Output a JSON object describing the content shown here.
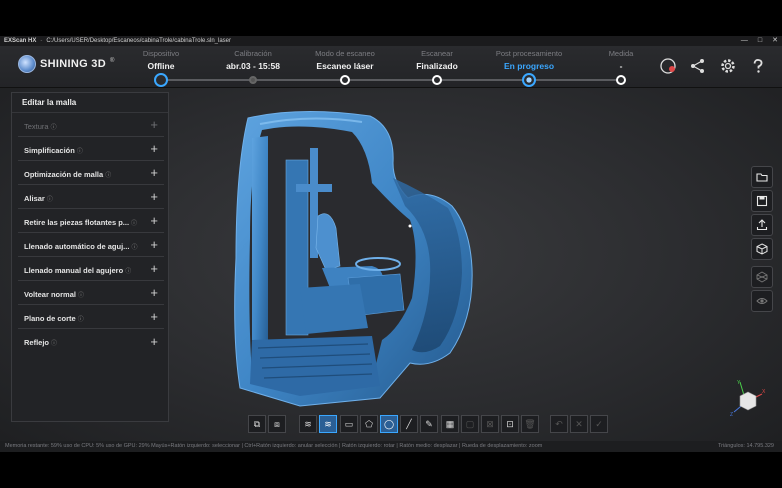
{
  "window": {
    "app_name": "EXScan HX",
    "path": "C:/Users/USER/Desktop/Escaneos/cabinaTrole/cabinaTrole.sln_laser",
    "controls": [
      "—",
      "□",
      "✕"
    ]
  },
  "brand": {
    "name": "SHINING 3D",
    "reg": "®"
  },
  "steps": [
    {
      "label": "Dispositivo",
      "value": "Offline",
      "state": "done"
    },
    {
      "label": "Calibración",
      "value": "abr.03 - 15:58",
      "state": "gray"
    },
    {
      "label": "Modo de escaneo",
      "value": "Escaneo láser",
      "state": "normal"
    },
    {
      "label": "Escanear",
      "value": "Finalizado",
      "state": "normal"
    },
    {
      "label": "Post procesamiento",
      "value": "En progreso",
      "state": "current"
    },
    {
      "label": "Medida",
      "value": "-",
      "state": "normal"
    }
  ],
  "header_icons": [
    "model-icon",
    "share-icon",
    "settings-icon",
    "help-icon"
  ],
  "panel": {
    "title": "Editar la malla",
    "items": [
      {
        "label": "Textura",
        "disabled": true
      },
      {
        "label": "Simplificación",
        "disabled": false
      },
      {
        "label": "Optimización de malla",
        "disabled": false
      },
      {
        "label": "Alisar",
        "disabled": false
      },
      {
        "label": "Retire las piezas flotantes p...",
        "disabled": false
      },
      {
        "label": "Llenado automático de aguj...",
        "disabled": false
      },
      {
        "label": "Llenado manual del agujero",
        "disabled": false
      },
      {
        "label": "Voltear normal",
        "disabled": false
      },
      {
        "label": "Plano de corte",
        "disabled": false
      },
      {
        "label": "Reflejo",
        "disabled": false
      }
    ],
    "info_glyph": "ⓘ",
    "plus_glyph": "+"
  },
  "status_bar": {
    "text": "Memoria restante: 59%  uso de CPU: 5%  uso de GPU: 29%  Mayús+Ratón izquierdo: seleccionar | Ctrl+Ratón izquierdo: anular selección | Ratón izquierdo: rotar | Ratón medio: desplazar | Rueda de desplazamiento: zoom",
    "triangles": "Triángulos: 14.795.329"
  },
  "axes": {
    "x": "X",
    "y": "Y",
    "z": "Z"
  },
  "colors": {
    "accent": "#3aa7ff",
    "model": "#3f86c6"
  }
}
